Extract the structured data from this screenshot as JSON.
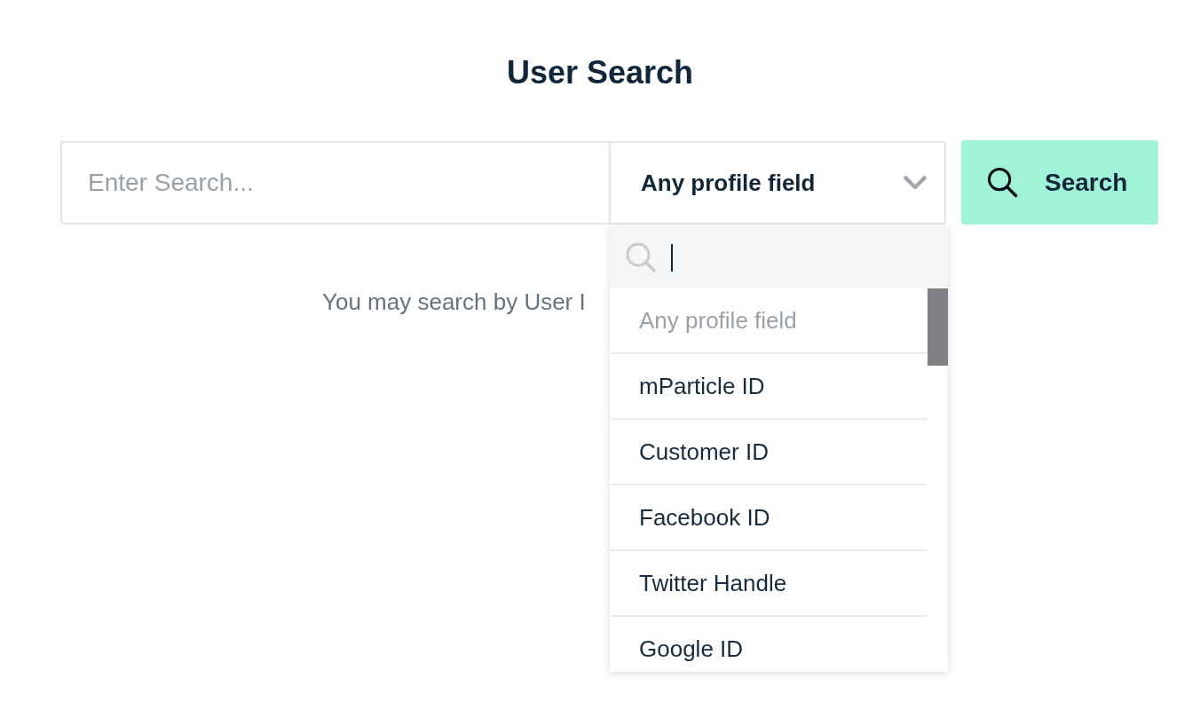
{
  "title": "User Search",
  "search_field": {
    "placeholder": "Enter Search..."
  },
  "field_select": {
    "value": "Any profile field",
    "expanded": true
  },
  "search_button": {
    "label": "Search"
  },
  "hint": "You may search by User I",
  "dropdown": {
    "search": {
      "focused": true
    },
    "options": [
      {
        "label": "Any profile field",
        "selected": true
      },
      {
        "label": "mParticle ID",
        "selected": false
      },
      {
        "label": "Customer ID",
        "selected": false
      },
      {
        "label": "Facebook ID",
        "selected": false
      },
      {
        "label": "Twitter Handle",
        "selected": false
      },
      {
        "label": "Google ID",
        "selected": false
      }
    ]
  }
}
